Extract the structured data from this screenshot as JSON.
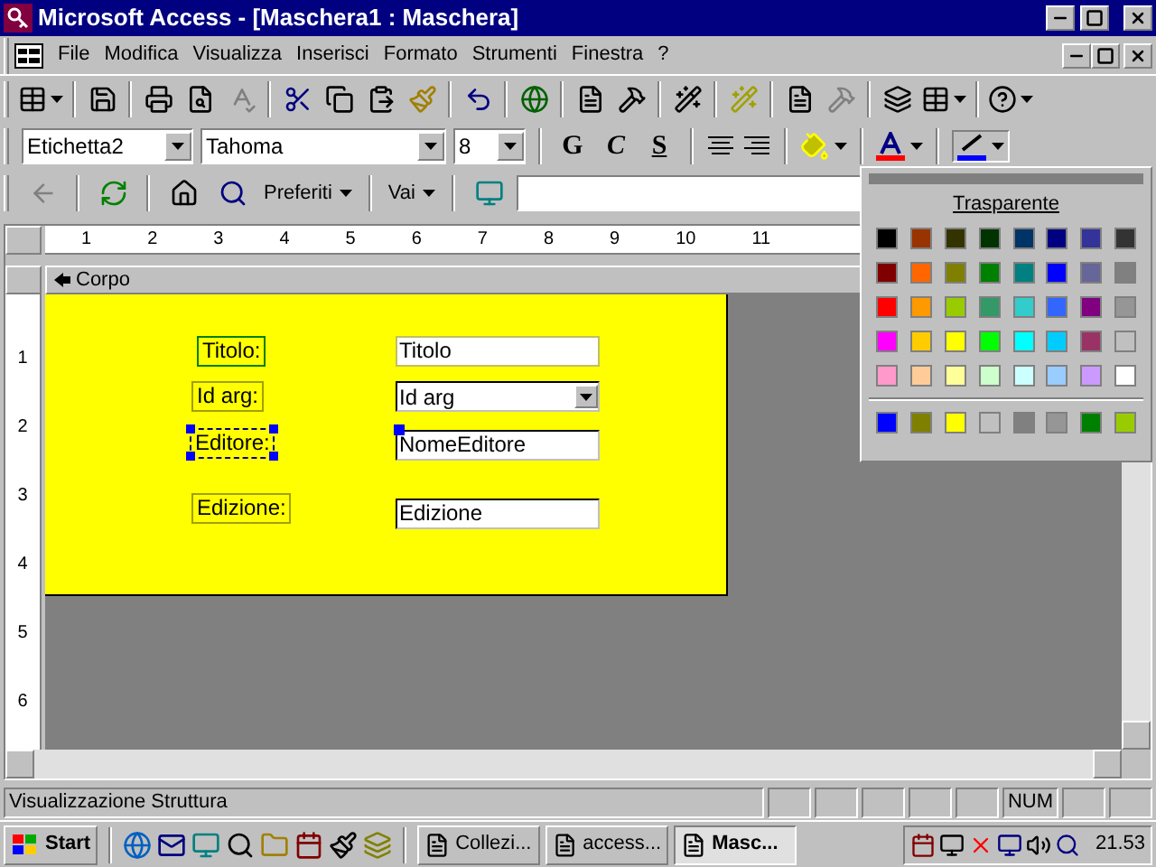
{
  "window": {
    "title": "Microsoft Access - [Maschera1 : Maschera]"
  },
  "menu": [
    "File",
    "Modifica",
    "Visualizza",
    "Inserisci",
    "Formato",
    "Strumenti",
    "Finestra",
    "?"
  ],
  "format_toolbar": {
    "object": "Etichetta2",
    "font": "Tahoma",
    "size": "8",
    "styles": [
      "G",
      "C",
      "S"
    ]
  },
  "web_toolbar": {
    "favorites": "Preferiti",
    "go": "Vai"
  },
  "ruler": {
    "horizontal": [
      "1",
      "2",
      "3",
      "4",
      "5",
      "6",
      "7",
      "8",
      "9",
      "10",
      "11"
    ],
    "vertical": [
      "1",
      "2",
      "3",
      "4",
      "5",
      "6"
    ]
  },
  "section": {
    "title": "Corpo"
  },
  "form_controls": [
    {
      "kind": "label",
      "text": "Titolo:",
      "selected": false
    },
    {
      "kind": "textbox",
      "text": "Titolo",
      "selected": false
    },
    {
      "kind": "label",
      "text": "Id arg:",
      "selected": false
    },
    {
      "kind": "combobox",
      "text": "Id arg",
      "selected": false
    },
    {
      "kind": "label",
      "text": "Editore:",
      "selected": true
    },
    {
      "kind": "textbox",
      "text": "NomeEditore",
      "selected": false
    },
    {
      "kind": "label",
      "text": "Edizione:",
      "selected": false
    },
    {
      "kind": "textbox",
      "text": "Edizione",
      "selected": false
    }
  ],
  "color_palette": {
    "title": "Trasparente",
    "colors": [
      {
        "color": "#000000"
      },
      {
        "color": "#993300"
      },
      {
        "color": "#333300"
      },
      {
        "color": "#003300"
      },
      {
        "color": "#003366"
      },
      {
        "color": "#000080"
      },
      {
        "color": "#333399"
      },
      {
        "color": "#333333"
      },
      {
        "color": "#800000"
      },
      {
        "color": "#ff6600"
      },
      {
        "color": "#808000"
      },
      {
        "color": "#008000"
      },
      {
        "color": "#008080"
      },
      {
        "color": "#0000ff"
      },
      {
        "color": "#666699"
      },
      {
        "color": "#808080"
      },
      {
        "color": "#ff0000"
      },
      {
        "color": "#ff9900"
      },
      {
        "color": "#99cc00"
      },
      {
        "color": "#339966"
      },
      {
        "color": "#33cccc"
      },
      {
        "color": "#3366ff"
      },
      {
        "color": "#800080"
      },
      {
        "color": "#969696"
      },
      {
        "color": "#ff00ff"
      },
      {
        "color": "#ffcc00"
      },
      {
        "color": "#ffff00"
      },
      {
        "color": "#00ff00"
      },
      {
        "color": "#00ffff"
      },
      {
        "color": "#00ccff"
      },
      {
        "color": "#993366"
      },
      {
        "color": "#c0c0c0"
      },
      {
        "color": "#ff99cc"
      },
      {
        "color": "#ffcc99"
      },
      {
        "color": "#ffff99"
      },
      {
        "color": "#ccffcc"
      },
      {
        "color": "#ccffff"
      },
      {
        "color": "#99ccff"
      },
      {
        "color": "#cc99ff"
      },
      {
        "color": "#ffffff"
      }
    ],
    "recent": [
      {
        "color": "#0000ff"
      },
      {
        "color": "#808000"
      },
      {
        "color": "#ffff00"
      },
      {
        "color": "#c0c0c0"
      },
      {
        "color": "#808080"
      },
      {
        "color": "#969696"
      },
      {
        "color": "#008000"
      },
      {
        "color": "#99cc00"
      }
    ]
  },
  "status_bar": {
    "text": "Visualizzazione Struttura",
    "indicators": [
      "NUM"
    ]
  },
  "taskbar": {
    "start": "Start",
    "tasks": [
      {
        "label": "Collezi...",
        "selected": false
      },
      {
        "label": "access...",
        "selected": false
      },
      {
        "label": "Masc...",
        "selected": true
      }
    ],
    "clock": "21.53"
  }
}
